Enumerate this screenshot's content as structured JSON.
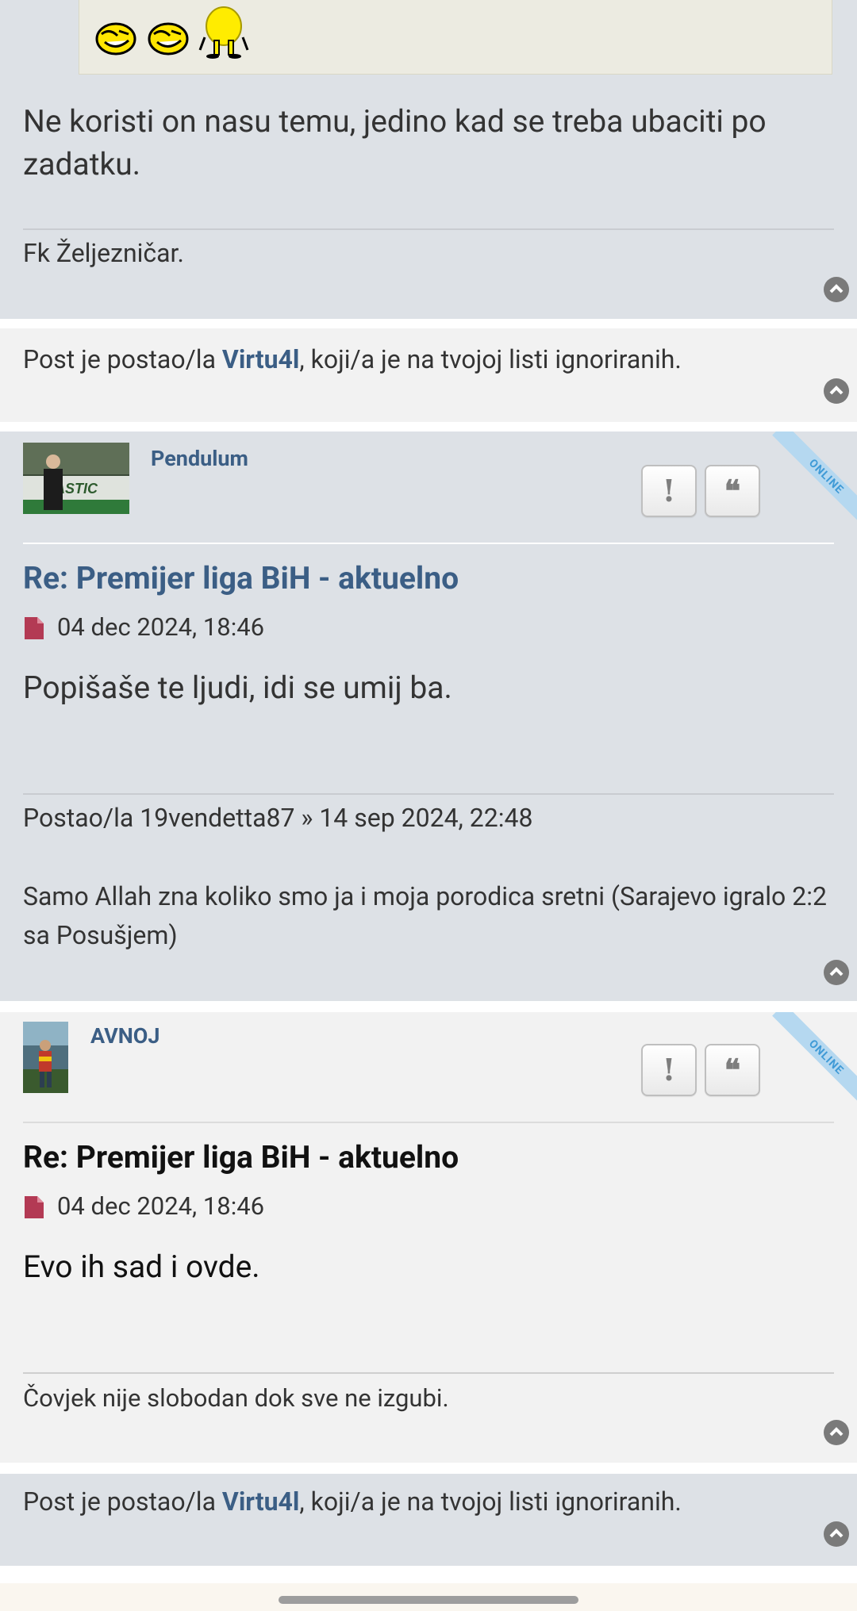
{
  "colors": {
    "post_bg_blue": "#dde1e6",
    "post_bg_light": "#f2f2f2",
    "username_blue": "#3b5e85",
    "post_icon_red": "#b33a54",
    "online_badge": "#b5d8f0"
  },
  "post_prev": {
    "body": "Ne koristi on nasu temu, jedino kad se treba ubaciti po zadatku.",
    "signature": "Fk Željezničar."
  },
  "ignored_1": {
    "prefix": "Post je postao/la ",
    "user": "Virtu4l",
    "suffix": ", koji/a je na tvojoj listi ignoriranih."
  },
  "post_pendulum": {
    "username": "Pendulum",
    "online_label": "ONLINE",
    "report_label": "!",
    "quote_label": "❝",
    "title": "Re: Premijer liga BiH - aktuelno",
    "date": "04 dec 2024, 18:46",
    "body": "Popišaše te ljudi, idi se umij ba.",
    "sig_quote_header": "Postao/la 19vendetta87 » 14 sep 2024, 22:48",
    "sig_quote_text": "Samo Allah zna koliko smo ja i moja porodica sretni (Sarajevo igralo 2:2 sa Posušjem)"
  },
  "post_avnoj": {
    "username": "AVNOJ",
    "online_label": "ONLINE",
    "report_label": "!",
    "quote_label": "❝",
    "title": "Re: Premijer liga BiH - aktuelno",
    "date": "04 dec 2024, 18:46",
    "body": "Evo ih sad i ovde.",
    "signature": "Čovjek nije slobodan dok sve ne izgubi."
  },
  "ignored_2": {
    "prefix": "Post je postao/la ",
    "user": "Virtu4l",
    "suffix": ", koji/a je na tvojoj listi ignoriranih."
  }
}
